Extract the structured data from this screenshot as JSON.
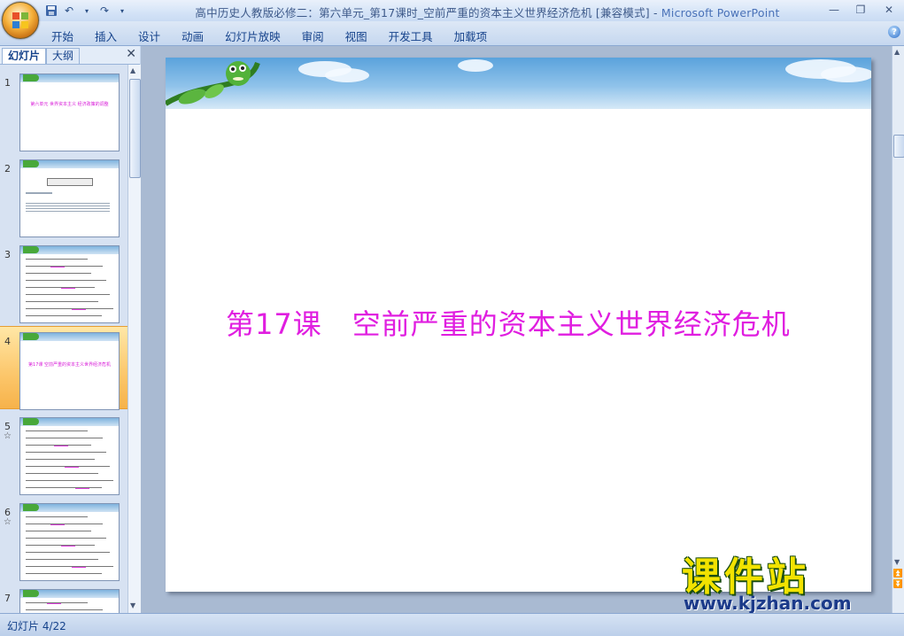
{
  "window": {
    "title_doc": "高中历史人教版必修二：第六单元_第17课时_空前严重的资本主义世界经济危机 [兼容模式]",
    "title_sep": " - ",
    "title_app": "Microsoft PowerPoint"
  },
  "qat": {
    "save_icon": "save-icon",
    "undo_icon": "undo-icon",
    "redo_icon": "redo-icon",
    "customize_icon": "dropdown-icon"
  },
  "ribbon": {
    "tabs": [
      "开始",
      "插入",
      "设计",
      "动画",
      "幻灯片放映",
      "审阅",
      "视图",
      "开发工具",
      "加载项"
    ]
  },
  "panel": {
    "tab_slides": "幻灯片",
    "tab_outline": "大纲",
    "close": "✕",
    "thumbs": [
      {
        "num": "1",
        "star": "",
        "caption": "第六单元 世界资本主义 经济政策的调整"
      },
      {
        "num": "2",
        "star": "",
        "caption": ""
      },
      {
        "num": "3",
        "star": "",
        "caption": ""
      },
      {
        "num": "4",
        "star": "",
        "caption": "第17课 空前严重的资本主义世界经济危机"
      },
      {
        "num": "5",
        "star": "☆",
        "caption": ""
      },
      {
        "num": "6",
        "star": "☆",
        "caption": ""
      },
      {
        "num": "7",
        "star": "",
        "caption": ""
      }
    ]
  },
  "slide": {
    "title_lesson": "第17课",
    "title_main": "空前严重的资本主义世界经济危机",
    "title_color": "#e01ee0"
  },
  "watermark": {
    "text": "课件站",
    "url": "www.kjzhan.com"
  },
  "status": {
    "slide_indicator": "幻灯片 4/22"
  },
  "colors": {
    "ribbon_text": "#15428b",
    "selected_thumb": "#fcc66a",
    "workspace": "#a9bad2"
  }
}
